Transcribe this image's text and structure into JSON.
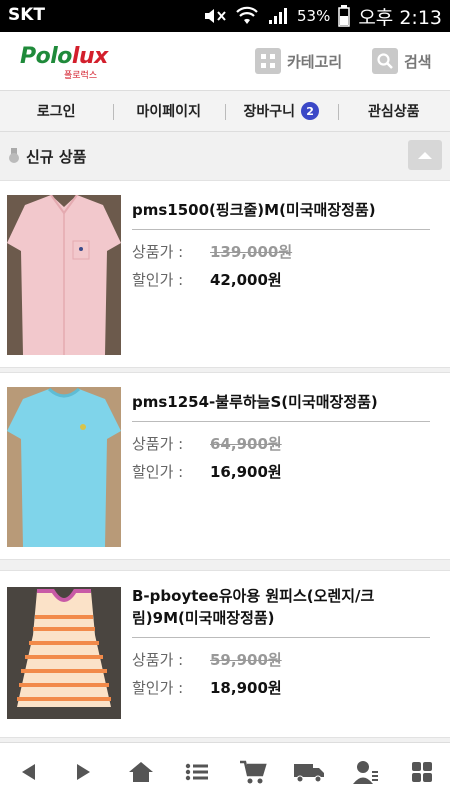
{
  "status_bar": {
    "carrier": "SKT",
    "battery": "53%",
    "time": "오후 2:13"
  },
  "header": {
    "logo": "Pololux",
    "logo_sub": "폴로럭스",
    "category_label": "카테고리",
    "search_label": "검색"
  },
  "nav": {
    "login": "로그인",
    "mypage": "마이페이지",
    "cart": "장바구니",
    "cart_count": "2",
    "wishlist": "관심상품"
  },
  "section": {
    "title": "신규 상품"
  },
  "products": [
    {
      "name": "pms1500(핑크줄)M(미국매장정품)",
      "list_label": "상품가 :",
      "list_price": "139,000원",
      "sale_label": "할인가 :",
      "sale_price": "42,000원"
    },
    {
      "name": "pms1254-불루하늘S(미국매장정품)",
      "list_label": "상품가 :",
      "list_price": "64,900원",
      "sale_label": "할인가 :",
      "sale_price": "16,900원"
    },
    {
      "name": "B-pboytee유아용 원피스(오렌지/크림)9M(미국매장정품)",
      "list_label": "상품가 :",
      "list_price": "59,900원",
      "sale_label": "할인가 :",
      "sale_price": "18,900원"
    }
  ],
  "bottom_nav": [
    "back-icon",
    "forward-icon",
    "home-icon",
    "list-icon",
    "cart-icon",
    "delivery-icon",
    "member-icon",
    "menu-grid-icon"
  ],
  "colors": {
    "brand_green": "#1f8a3a",
    "brand_red": "#d31f2c",
    "badge": "#3b48c7"
  }
}
